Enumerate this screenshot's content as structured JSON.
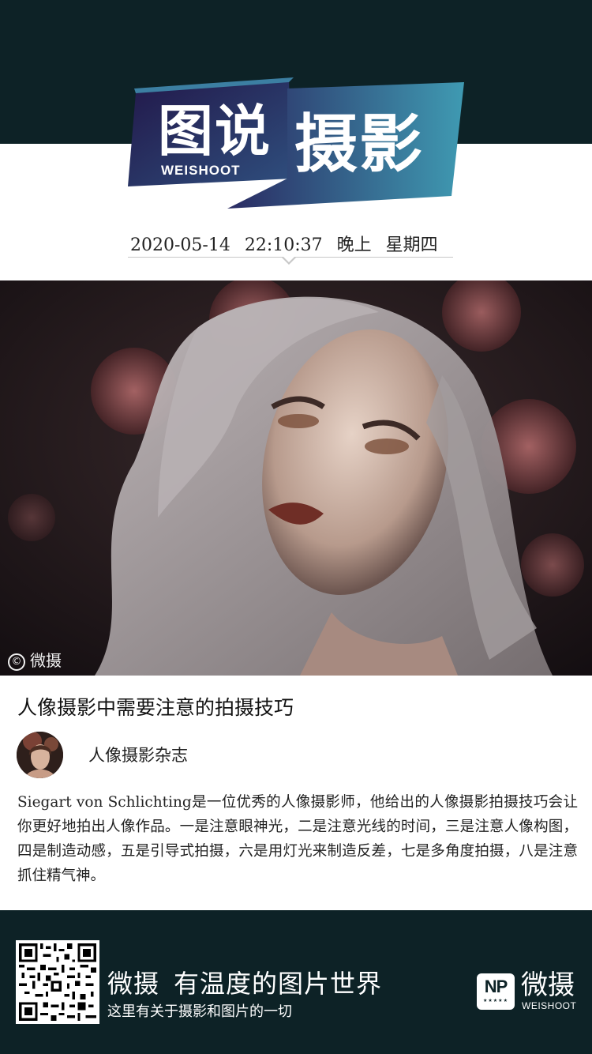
{
  "header": {
    "logo_left": "图说",
    "logo_sub": "WEISHOOT",
    "logo_right": "摄影",
    "date": "2020-05-14",
    "time": "22:10:37",
    "period": "晚上",
    "weekday": "星期四"
  },
  "photo": {
    "watermark_icon": "©",
    "watermark_text": "微摄"
  },
  "article": {
    "title": "人像摄影中需要注意的拍摄技巧",
    "author": "人像摄影杂志",
    "body": " Siegart von Schlichting是一位优秀的人像摄影师，他给出的人像摄影拍摄技巧会让你更好地拍出人像作品。一是注意眼神光，二是注意光线的时间，三是注意人像构图，四是制造动感，五是引导式拍摄，六是用灯光来制造反差，七是多角度拍摄，八是注意抓住精气神。"
  },
  "footer": {
    "slogan_brand": "微摄",
    "slogan_text": "有温度的图片世界",
    "subtitle": "这里有关于摄影和图片的一切",
    "np_mark": "NP",
    "np_stars": "★★★★★",
    "brand_cn": "微摄",
    "brand_en": "WEISHOOT"
  },
  "colors": {
    "dark_band": "#0d2226",
    "logo_gradient_start": "#241a4e",
    "logo_gradient_end": "#3e93ab"
  }
}
